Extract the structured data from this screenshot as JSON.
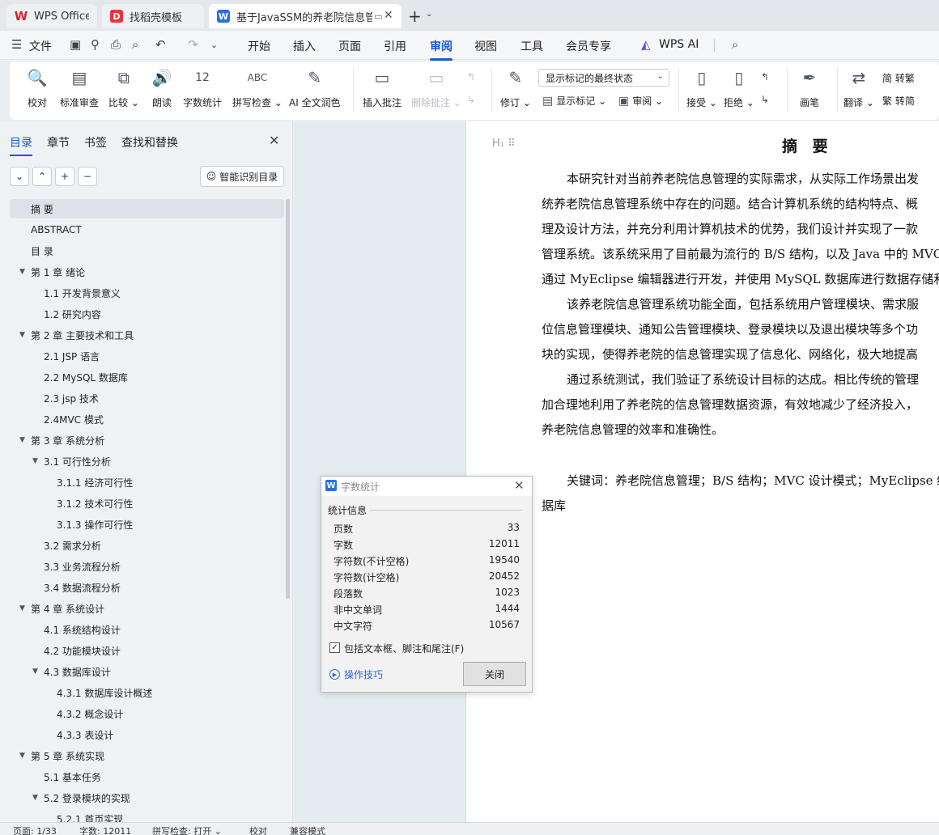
{
  "tabs": {
    "wps": "WPS Office",
    "template": "找稻壳模板",
    "doc": "基于JavaSSM的养老院信息管"
  },
  "menu": {
    "file": "文件",
    "items": [
      "开始",
      "插入",
      "页面",
      "引用",
      "审阅",
      "视图",
      "工具",
      "会员专享"
    ],
    "wpsai": "WPS AI"
  },
  "ribbon": {
    "proofread": "校对",
    "std_review": "标准审查",
    "compare": "比较",
    "read_aloud": "朗读",
    "word_count": "字数统计",
    "spell_check": "拼写检查",
    "ai_polish": "AI 全文润色",
    "insert_comment": "插入批注",
    "delete_comment": "删除批注",
    "track": "修订",
    "markup_dropdown": "显示标记的最终状态",
    "show_markup": "显示标记",
    "review": "审阅",
    "accept": "接受",
    "reject": "拒绝",
    "pen": "画笔",
    "translate": "翻译",
    "to_traditional": "简 转繁",
    "to_simplified": "繁 转简"
  },
  "nav": {
    "tabs": [
      "目录",
      "章节",
      "书签",
      "查找和替换"
    ],
    "smart_toc": "智能识别目录",
    "toc": [
      {
        "label": "摘 要",
        "level": 1,
        "caret": ""
      },
      {
        "label": "ABSTRACT",
        "level": 1,
        "caret": ""
      },
      {
        "label": "目  录",
        "level": 1,
        "caret": ""
      },
      {
        "label": "第 1 章  绪论",
        "level": 1,
        "caret": "▼"
      },
      {
        "label": "1.1 开发背景意义",
        "level": 2,
        "caret": ""
      },
      {
        "label": "1.2 研究内容",
        "level": 2,
        "caret": ""
      },
      {
        "label": "第 2 章  主要技术和工具",
        "level": 1,
        "caret": "▼"
      },
      {
        "label": "2.1 JSP 语言",
        "level": 2,
        "caret": ""
      },
      {
        "label": "2.2 MySQL 数据库",
        "level": 2,
        "caret": ""
      },
      {
        "label": "2.3 jsp 技术",
        "level": 2,
        "caret": ""
      },
      {
        "label": "2.4MVC 模式",
        "level": 2,
        "caret": ""
      },
      {
        "label": "第 3 章  系统分析",
        "level": 1,
        "caret": "▼"
      },
      {
        "label": "3.1 可行性分析",
        "level": 2,
        "caret": "▼"
      },
      {
        "label": "3.1.1 经济可行性",
        "level": 3,
        "caret": ""
      },
      {
        "label": "3.1.2 技术可行性",
        "level": 3,
        "caret": ""
      },
      {
        "label": "3.1.3 操作可行性",
        "level": 3,
        "caret": ""
      },
      {
        "label": "3.2 需求分析",
        "level": 2,
        "caret": ""
      },
      {
        "label": "3.3 业务流程分析",
        "level": 2,
        "caret": ""
      },
      {
        "label": "3.4 数据流程分析",
        "level": 2,
        "caret": ""
      },
      {
        "label": "第 4 章  系统设计",
        "level": 1,
        "caret": "▼"
      },
      {
        "label": "4.1 系统结构设计",
        "level": 2,
        "caret": ""
      },
      {
        "label": "4.2 功能模块设计",
        "level": 2,
        "caret": ""
      },
      {
        "label": "4.3 数据库设计",
        "level": 2,
        "caret": "▼"
      },
      {
        "label": "4.3.1 数据库设计概述",
        "level": 3,
        "caret": ""
      },
      {
        "label": "4.3.2 概念设计",
        "level": 3,
        "caret": ""
      },
      {
        "label": "4.3.3 表设计",
        "level": 3,
        "caret": ""
      },
      {
        "label": "第 5 章    系统实现",
        "level": 1,
        "caret": "▼"
      },
      {
        "label": "5.1 基本任务",
        "level": 2,
        "caret": ""
      },
      {
        "label": "5.2 登录模块的实现",
        "level": 2,
        "caret": "▼"
      },
      {
        "label": "5.2.1 首页实现",
        "level": 3,
        "caret": ""
      }
    ]
  },
  "document": {
    "title": "摘 要",
    "lines": [
      "本研究针对当前养老院信息管理的实际需求，从实际工作场景出发",
      "统养老院信息管理系统中存在的问题。结合计算机系统的结构特点、概",
      "理及设计方法，并充分利用计算机技术的优势，我们设计并实现了一款",
      "管理系统。该系统采用了目前最为流行的 B/S 结构，以及 Java 中的 MVC",
      "通过 MyEclipse 编辑器进行开发，并使用 MySQL 数据库进行数据存储和",
      "该养老院信息管理系统功能全面，包括系统用户管理模块、需求服",
      "位信息管理模块、通知公告管理模块、登录模块以及退出模块等多个功",
      "块的实现，使得养老院的信息管理实现了信息化、网络化，极大地提高",
      "通过系统测试，我们验证了系统设计目标的达成。相比传统的管理",
      "加合理地利用了养老院的信息管理数据资源，有效地减少了经济投入，",
      "养老院信息管理的效率和准确性。",
      "关键词：养老院信息管理；B/S 结构；MVC 设计模式；MyEclipse 编",
      "据库"
    ]
  },
  "dialog": {
    "title": "字数统计",
    "group": "统计信息",
    "stats": [
      {
        "label": "页数",
        "value": "33"
      },
      {
        "label": "字数",
        "value": "12011"
      },
      {
        "label": "字符数(不计空格)",
        "value": "19540"
      },
      {
        "label": "字符数(计空格)",
        "value": "20452"
      },
      {
        "label": "段落数",
        "value": "1023"
      },
      {
        "label": "非中文单词",
        "value": "1444"
      },
      {
        "label": "中文字符",
        "value": "10567"
      }
    ],
    "checkbox": "包括文本框、脚注和尾注(F)",
    "checked": true,
    "tips": "操作技巧",
    "close": "关闭"
  },
  "status": {
    "page": "页面: 1/33",
    "words": "字数: 12011",
    "spell": "拼写检查: 打开",
    "proof": "校对",
    "compat": "兼容模式"
  }
}
